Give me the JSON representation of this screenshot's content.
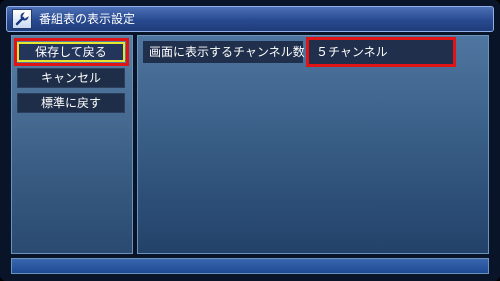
{
  "window": {
    "title": "番組表の表示設定",
    "icon": "settings-icon"
  },
  "sidebar": {
    "items": [
      {
        "label": "保存して戻る",
        "selected": true
      },
      {
        "label": "キャンセル",
        "selected": false
      },
      {
        "label": "標準に戻す",
        "selected": false
      }
    ]
  },
  "settings": {
    "channels_label": "画面に表示するチャンネル数",
    "channels_value": "５チャンネル"
  },
  "colors": {
    "highlight_red": "#e01414",
    "focus_yellow": "#e6e632",
    "title_bar": "#284a90"
  }
}
